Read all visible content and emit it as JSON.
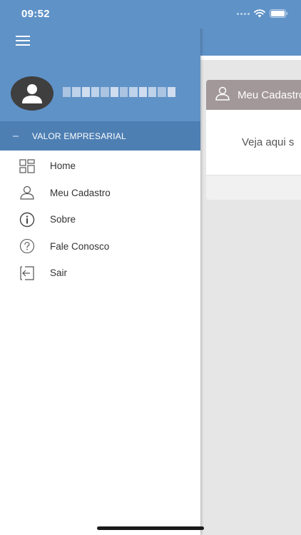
{
  "status_bar": {
    "time": "09:52"
  },
  "main": {
    "card_title": "Meu Cadastro",
    "card_text": "Veja aqui s"
  },
  "drawer": {
    "company_name": "VALOR EMPRESARIAL",
    "menu": [
      {
        "label": "Home",
        "icon": "grid-icon"
      },
      {
        "label": "Meu Cadastro",
        "icon": "user-icon"
      },
      {
        "label": "Sobre",
        "icon": "info-icon"
      },
      {
        "label": "Fale Conosco",
        "icon": "help-icon"
      },
      {
        "label": "Sair",
        "icon": "logout-icon"
      }
    ]
  },
  "colors": {
    "header_blue": "#5f92c7",
    "company_bar_blue": "#4d7fb3",
    "card_header_gray": "#a2989a",
    "avatar_dark": "#3f3f3f"
  }
}
